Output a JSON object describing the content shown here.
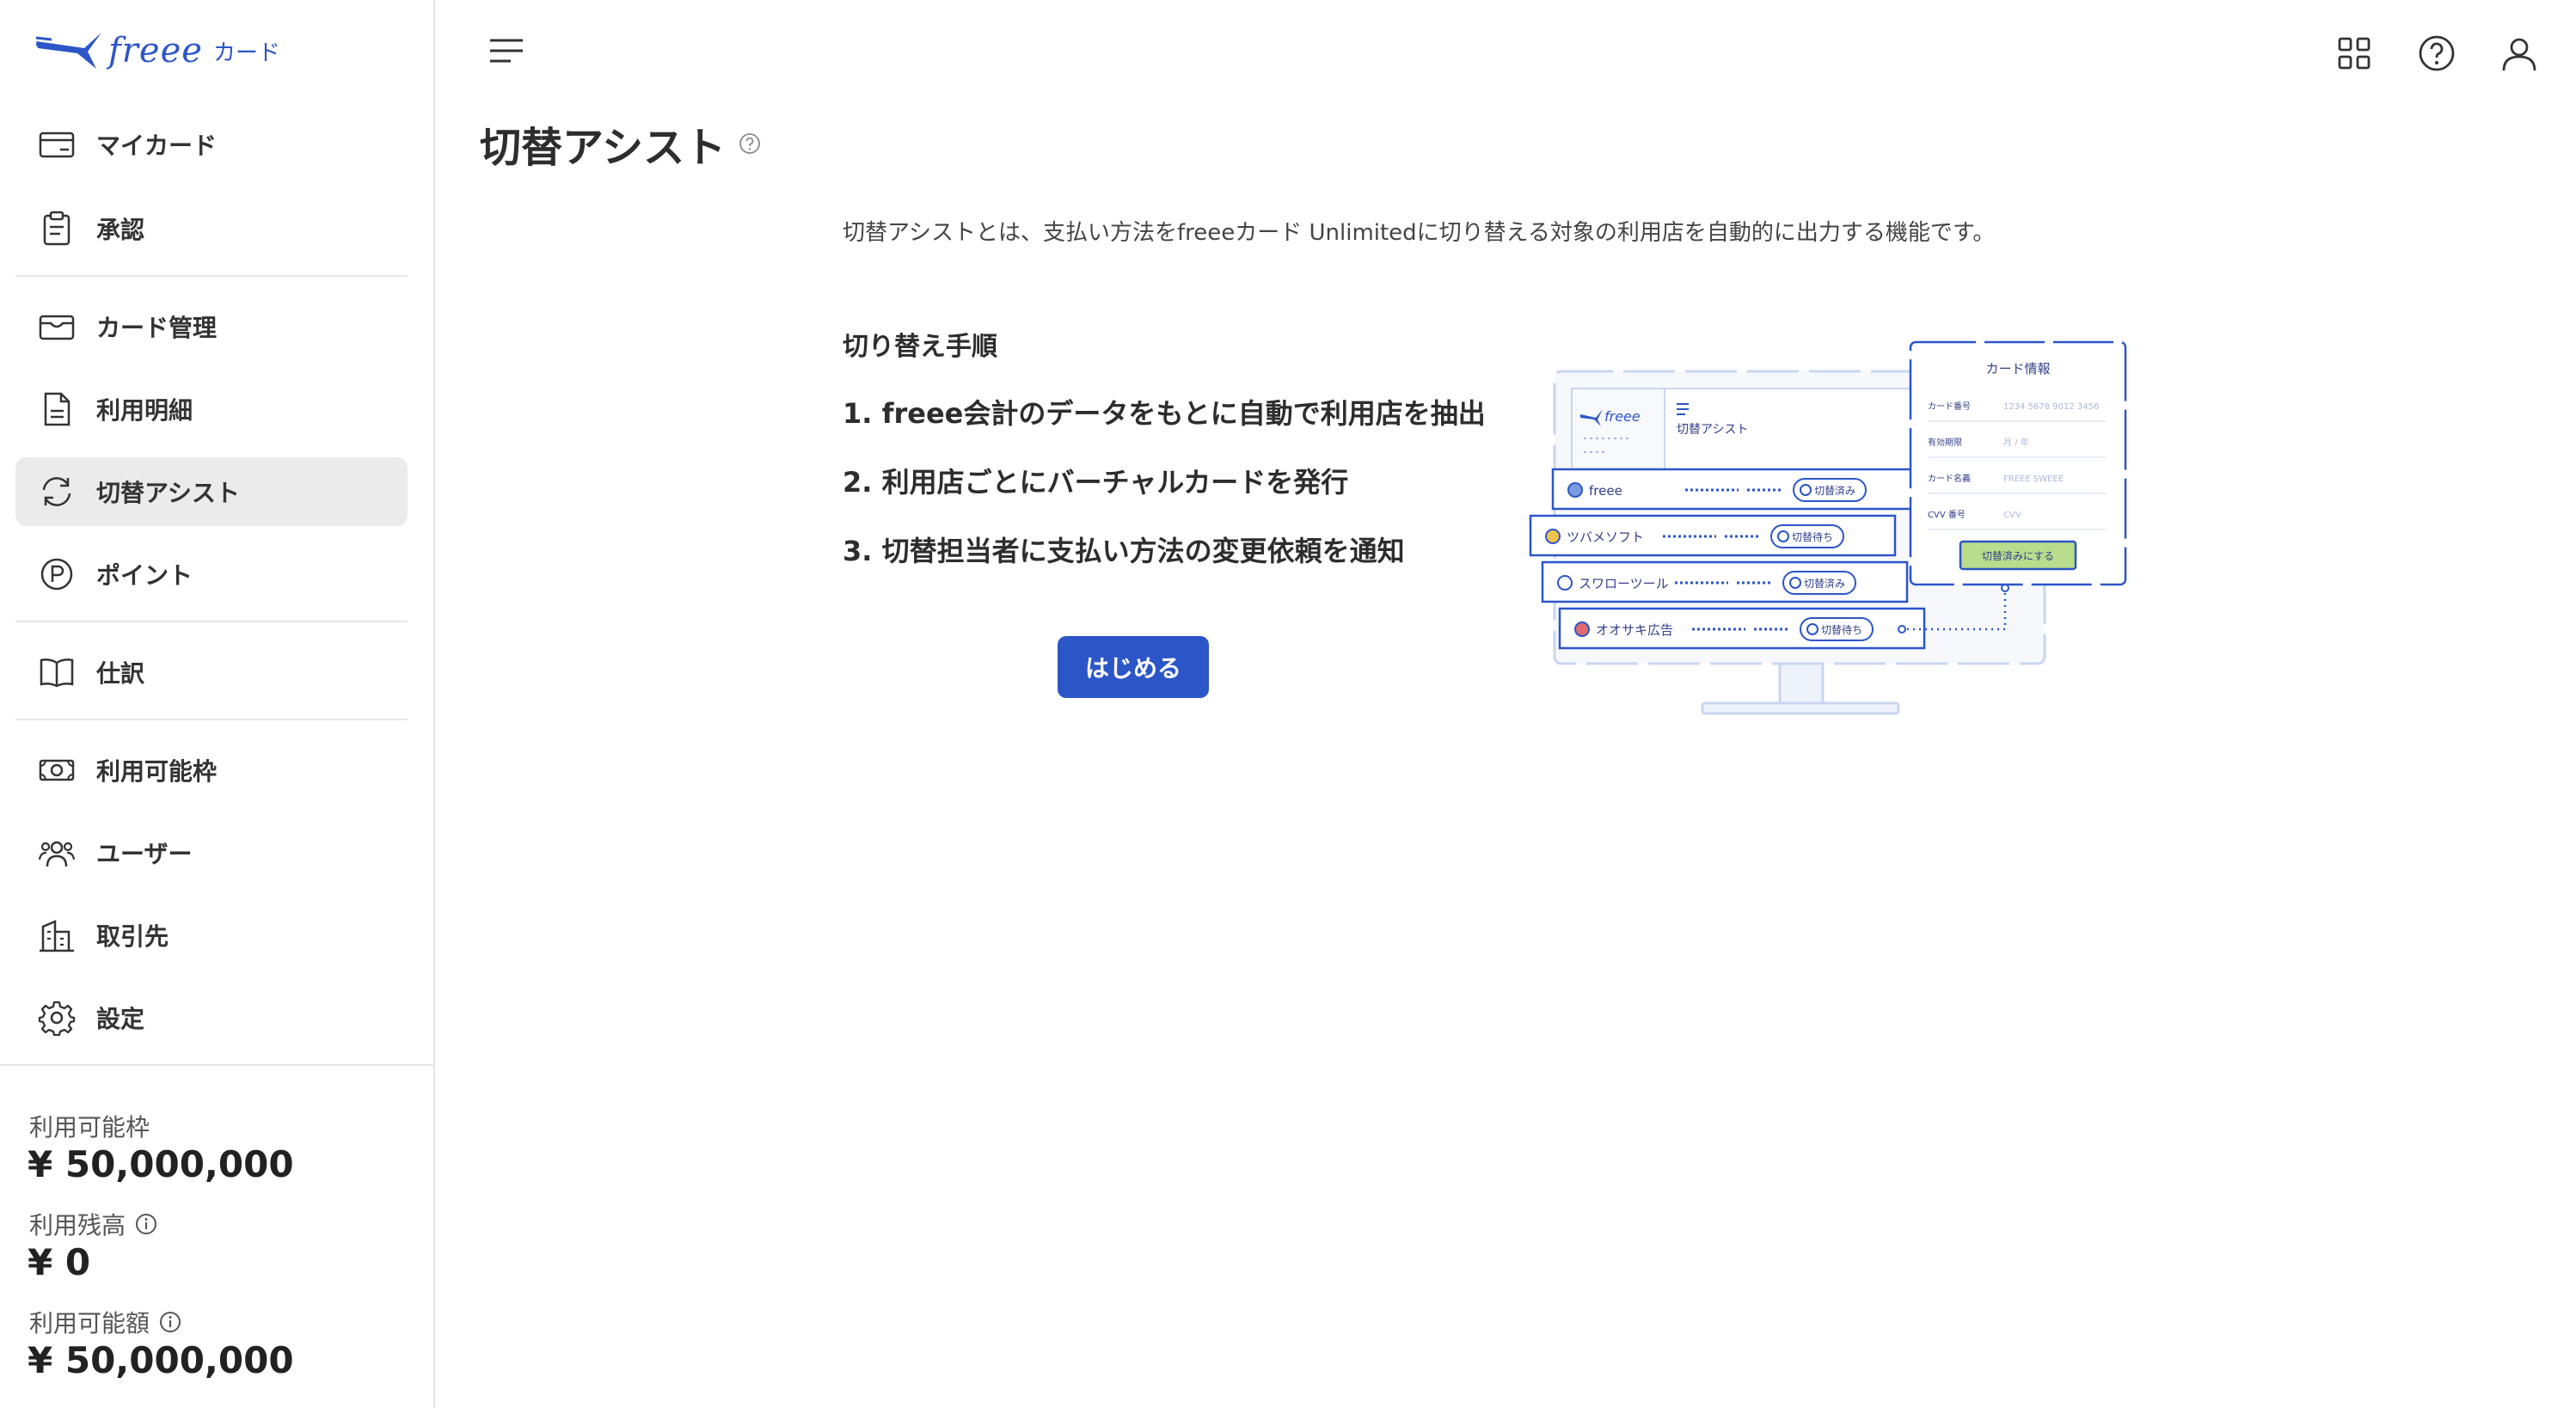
{
  "logo": {
    "brand": "freee",
    "sub": "カード"
  },
  "sidebar": {
    "items": [
      {
        "label": "マイカード",
        "icon": "card-icon"
      },
      {
        "label": "承認",
        "icon": "clipboard-icon"
      },
      {
        "label": "カード管理",
        "icon": "wallet-icon"
      },
      {
        "label": "利用明細",
        "icon": "document-icon"
      },
      {
        "label": "切替アシスト",
        "icon": "sync-icon",
        "active": true
      },
      {
        "label": "ポイント",
        "icon": "point-icon"
      },
      {
        "label": "仕訳",
        "icon": "book-icon"
      },
      {
        "label": "利用可能枠",
        "icon": "money-icon"
      },
      {
        "label": "ユーザー",
        "icon": "users-icon"
      },
      {
        "label": "取引先",
        "icon": "building-icon"
      },
      {
        "label": "設定",
        "icon": "gear-icon"
      }
    ]
  },
  "summary": {
    "limit_label": "利用可能枠",
    "limit_value": "¥ 50,000,000",
    "balance_label": "利用残高",
    "balance_value": "¥ 0",
    "available_label": "利用可能額",
    "available_value": "¥ 50,000,000"
  },
  "main": {
    "title": "切替アシスト",
    "description": "切替アシストとは、支払い方法をfreeeカード Unlimitedに切り替える対象の利用店を自動的に出力する機能です。",
    "steps_title": "切り替え手順",
    "steps": [
      "1. freee会計のデータをもとに自動で利用店を抽出",
      "2. 利用店ごとにバーチャルカードを発行",
      "3. 切替担当者に支払い方法の変更依頼を通知"
    ],
    "start_button": "はじめる"
  },
  "illustration": {
    "app_logo": "freee",
    "screen_title": "切替アシスト",
    "card_panel_title": "カード情報",
    "card_fields": [
      {
        "label": "カード番号",
        "value": "1234 5678 9012 3456"
      },
      {
        "label": "有効期限",
        "value": "月 / 年"
      },
      {
        "label": "カード名義",
        "value": "FREEE SWEEE"
      },
      {
        "label": "CVV 番号",
        "value": "CVV"
      }
    ],
    "card_button": "切替済みにする",
    "merchants": [
      {
        "name": "freee",
        "status": "切替済み",
        "dot": "#7a9be0"
      },
      {
        "name": "ツバメソフト",
        "status": "切替待ち",
        "dot": "#f0c24b"
      },
      {
        "name": "スワローツール",
        "status": "切替済み",
        "dot": "#ffffff"
      },
      {
        "name": "オオサキ広告",
        "status": "切替待ち",
        "dot": "#e06a6a"
      }
    ]
  }
}
